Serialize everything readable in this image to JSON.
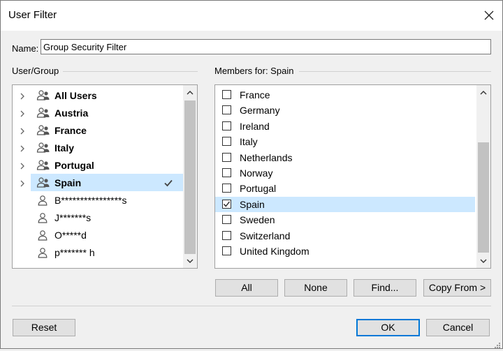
{
  "window": {
    "title": "User Filter"
  },
  "name_field": {
    "label": "Name:",
    "value": "Group Security Filter"
  },
  "user_group": {
    "caption": "User/Group",
    "rows": [
      {
        "label": "All Users",
        "kind": "group",
        "selected": false
      },
      {
        "label": "Austria",
        "kind": "group",
        "selected": false
      },
      {
        "label": "France",
        "kind": "group",
        "selected": false
      },
      {
        "label": "Italy",
        "kind": "group",
        "selected": false
      },
      {
        "label": "Portugal",
        "kind": "group",
        "selected": false
      },
      {
        "label": "Spain",
        "kind": "group",
        "selected": true
      },
      {
        "label": "B****************s",
        "kind": "user",
        "selected": false
      },
      {
        "label": "J*******s",
        "kind": "user",
        "selected": false
      },
      {
        "label": "O*****d",
        "kind": "user",
        "selected": false
      },
      {
        "label": "p******* h",
        "kind": "user",
        "selected": false
      }
    ]
  },
  "members": {
    "caption": "Members for: Spain",
    "rows": [
      {
        "label": "France",
        "checked": false
      },
      {
        "label": "Germany",
        "checked": false
      },
      {
        "label": "Ireland",
        "checked": false
      },
      {
        "label": "Italy",
        "checked": false
      },
      {
        "label": "Netherlands",
        "checked": false
      },
      {
        "label": "Norway",
        "checked": false
      },
      {
        "label": "Portugal",
        "checked": false
      },
      {
        "label": "Spain",
        "checked": true
      },
      {
        "label": "Sweden",
        "checked": false
      },
      {
        "label": "Switzerland",
        "checked": false
      },
      {
        "label": "United Kingdom",
        "checked": false
      }
    ]
  },
  "buttons": {
    "all": "All",
    "none": "None",
    "find": "Find...",
    "copy_from": "Copy From >",
    "reset": "Reset",
    "ok": "OK",
    "cancel": "Cancel"
  },
  "colors": {
    "selection": "#cce8ff",
    "accent": "#0078d7"
  }
}
